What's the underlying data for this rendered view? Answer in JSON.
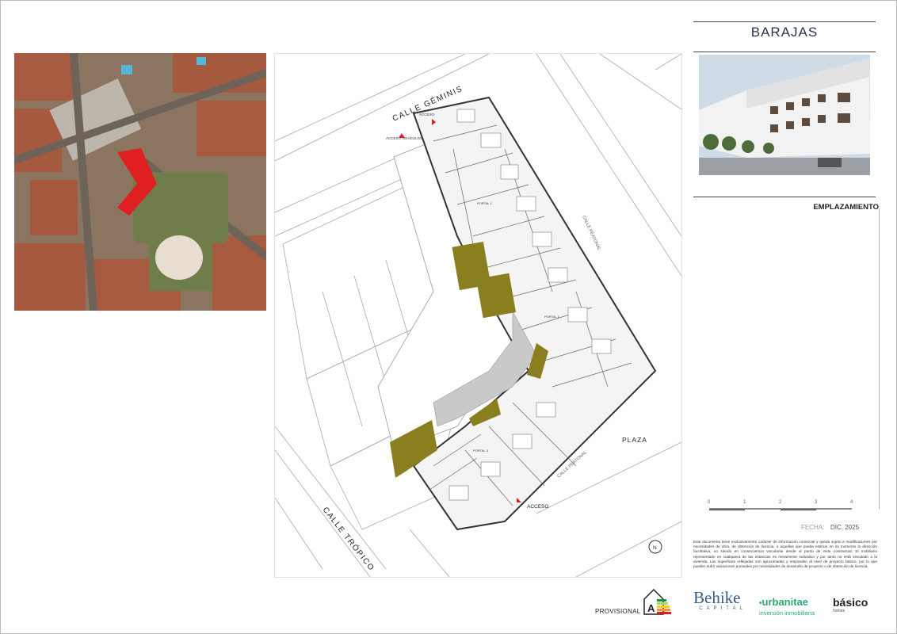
{
  "header": {
    "title": "BARAJAS"
  },
  "section": {
    "label": "EMPLAZAMIENTO"
  },
  "plan": {
    "street_top": "CALLE GÉMINIS",
    "street_bottom": "CALLE TRÓPICO",
    "street_right": "CALLE PEATONAL",
    "street_bottom_right": "CALLE PEATONAL",
    "plaza": "PLAZA",
    "access_top": "ACCESO",
    "access_vehicles": "ACCESO VEHÍCULOS",
    "access_bottom": "ACCESO",
    "portal1": "PORTAL 1",
    "portal2": "PORTAL 2",
    "portal3": "PORTAL 3",
    "north": "N"
  },
  "scale": {
    "ticks": [
      "0",
      "1",
      "2",
      "3",
      "4"
    ]
  },
  "fecha": {
    "label": "FECHA:",
    "value": "DIC. 2025"
  },
  "disclaimer": "Este documento tiene exclusivamente carácter de información comercial y queda sujeto a modificaciones por necesidades de obra, de obtención de licencia, o aquellas que pueda estimar en su momento la dirección facultativa, no siendo en consecuencia vinculante desde el punto de vista contractual. El mobiliario representado en cualquiera de las estancias es meramente indicativo y por tanto no está vinculado a la vivienda. Las superficies reflejadas son aproximadas y responden al nivel de proyecto básico, por lo que pueden sufrir variaciones puntuales por necesidades de desarrollo de proyecto o de obtención de licencia.",
  "footer": {
    "provisional": "PROVISIONAL",
    "energy_grade": "A",
    "logo_behike": "Behike",
    "logo_behike_sub": "CAPITAL",
    "logo_urbanitae": "urbanitae",
    "logo_urbanitae_sub": "inversión inmobiliaria",
    "logo_basico": "básico",
    "logo_basico_sub": "homes"
  },
  "colors": {
    "plot_highlight": "#e02020",
    "green_area": "#8a7f1e",
    "title": "#2b3550",
    "urbanitae": "#2aa870"
  }
}
